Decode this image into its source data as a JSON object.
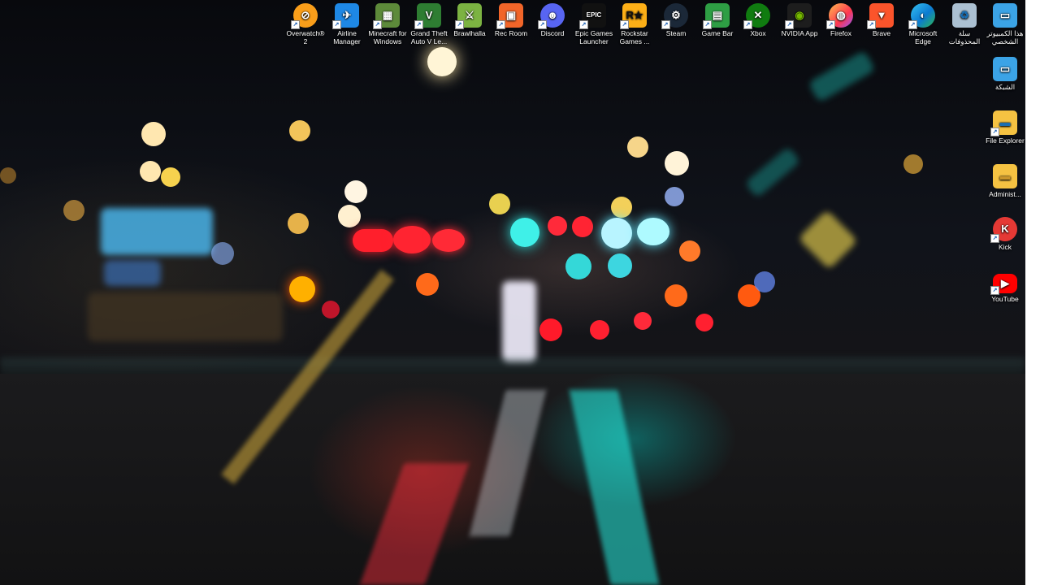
{
  "desktop": {
    "top_icons": [
      {
        "label": "Overwatch® 2",
        "icon": "overwatch-icon"
      },
      {
        "label": "Airline Manager",
        "icon": "airline-manager-icon"
      },
      {
        "label": "Minecraft for Windows",
        "icon": "minecraft-icon"
      },
      {
        "label": "Grand Theft Auto V Le...",
        "icon": "gta-v-icon"
      },
      {
        "label": "Brawlhalla",
        "icon": "brawlhalla-icon"
      },
      {
        "label": "Rec Room",
        "icon": "rec-room-icon"
      },
      {
        "label": "Discord",
        "icon": "discord-icon"
      },
      {
        "label": "Epic Games Launcher",
        "icon": "epic-games-icon"
      },
      {
        "label": "Rockstar Games ...",
        "icon": "rockstar-icon"
      },
      {
        "label": "Steam",
        "icon": "steam-icon"
      },
      {
        "label": "Game Bar",
        "icon": "game-bar-icon"
      },
      {
        "label": "Xbox",
        "icon": "xbox-icon"
      },
      {
        "label": "NVIDIA App",
        "icon": "nvidia-icon"
      },
      {
        "label": "Firefox",
        "icon": "firefox-icon"
      },
      {
        "label": "Brave",
        "icon": "brave-icon"
      },
      {
        "label": "Microsoft Edge",
        "icon": "edge-icon"
      },
      {
        "label": "سلة المحذوفات",
        "icon": "recycle-bin-icon"
      },
      {
        "label": "هذا الكمبيوتر الشخصي",
        "icon": "this-pc-icon"
      }
    ],
    "right_icons": [
      {
        "label": "الشبكة",
        "icon": "network-icon"
      },
      {
        "label": "File Explorer",
        "icon": "file-explorer-icon"
      },
      {
        "label": "Administ...",
        "icon": "folder-icon"
      },
      {
        "label": "Kick",
        "icon": "kick-icon"
      },
      {
        "label": "YouTube",
        "icon": "youtube-icon"
      }
    ],
    "icon_glyphs": {
      "overwatch": "⊘",
      "airline": "✈",
      "minecraft": "▦",
      "gta": "V",
      "brawlhalla": "⚔",
      "recroom": "▣",
      "discord": "☻",
      "epic": "EPIC",
      "rockstar": "R★",
      "steam": "⚙",
      "gamebar": "▤",
      "xbox": "✕",
      "nvidia": "◉",
      "firefox": "◍",
      "brave": "▼",
      "edge": "◐",
      "recycle": "♻",
      "thispc": "▭",
      "network": "▭",
      "explorer": "▬",
      "folder": "▬",
      "kick": "K",
      "youtube": "▶",
      "shortcut_arrow": "↗"
    },
    "colors": {
      "overwatch": "#f99e1a",
      "airline": "#1e88e5",
      "minecraft": "#5d8a3a",
      "gta": "#2e7d32",
      "brawlhalla": "#7cb342",
      "recroom": "#f16529",
      "discord": "#5865f2",
      "epic": "#111111",
      "rockstar": "#fcaf17",
      "steam": "#1b2838",
      "gamebar": "#2e9e44",
      "xbox": "#107c10",
      "nvidia": "#76b900",
      "firefox": "#ff7139",
      "brave": "#fb542b",
      "edge": "#0c7bd1",
      "recycle": "#9fc5e8",
      "thispc": "#3ba3e6",
      "folder": "#f5c242",
      "kick": "#e53935",
      "youtube": "#ff0000"
    }
  }
}
